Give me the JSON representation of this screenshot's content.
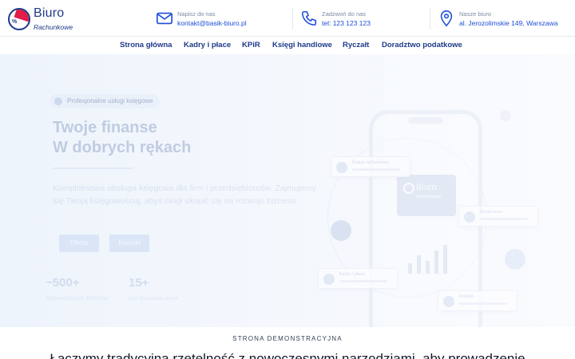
{
  "logo": {
    "title": "Biuro",
    "subtitle": "Rachunkowe",
    "icon": "pie-chart-logo-icon",
    "percent_sign": "%"
  },
  "contacts": [
    {
      "icon": "envelope-icon",
      "label": "Napisz do nas",
      "value": "kontakt@basik-biuro.pl"
    },
    {
      "icon": "phone-icon",
      "label": "Zadzwoń do nas",
      "value": "tel: 123 123 123"
    },
    {
      "icon": "location-pin-icon",
      "label": "Nasze biuro",
      "value": "al. Jerozolimskie 149, Warszawa"
    }
  ],
  "nav": [
    "Strona główna",
    "Kadry i płace",
    "KPiR",
    "Księgi handlowe",
    "Ryczałt",
    "Doradztwo podatkowe"
  ],
  "hero": {
    "pill": "Profesjonalne usługi księgowe",
    "title_line1": "Twoje finanse",
    "title_line2": "W dobrych rękach",
    "description": "Kompleksowa obsługa księgowa dla firm i przedsiębiorców. Zajmujemy się Twoją księgowością, abyś mógł skupić się na rozwoju biznesu.",
    "buttons": [
      "Oferta",
      "Kontakt"
    ],
    "stats": [
      {
        "value": "~500+",
        "label": "Zadowolonych klientów"
      },
      {
        "value": "15+",
        "label": "Lat doświadczenia"
      }
    ],
    "phone_screen": {
      "title": "Biuro",
      "subtitle": "Rachunkowe",
      "chart_values": [
        4,
        7,
        5,
        9,
        11
      ]
    },
    "float_cards": [
      "Księgi rachunkowe",
      "Rozliczenia",
      "Kadry i płace",
      "Podatki"
    ]
  },
  "section": {
    "tag": "STRONA DEMONSTRACYJNA",
    "lead": "Łączymy tradycyjną rzetelność z nowoczesnymi narzędziami, aby prowadzenie"
  },
  "colors": {
    "brand": "#1e3a8a",
    "accent": "#e11d48",
    "link": "#1d4ed8"
  }
}
